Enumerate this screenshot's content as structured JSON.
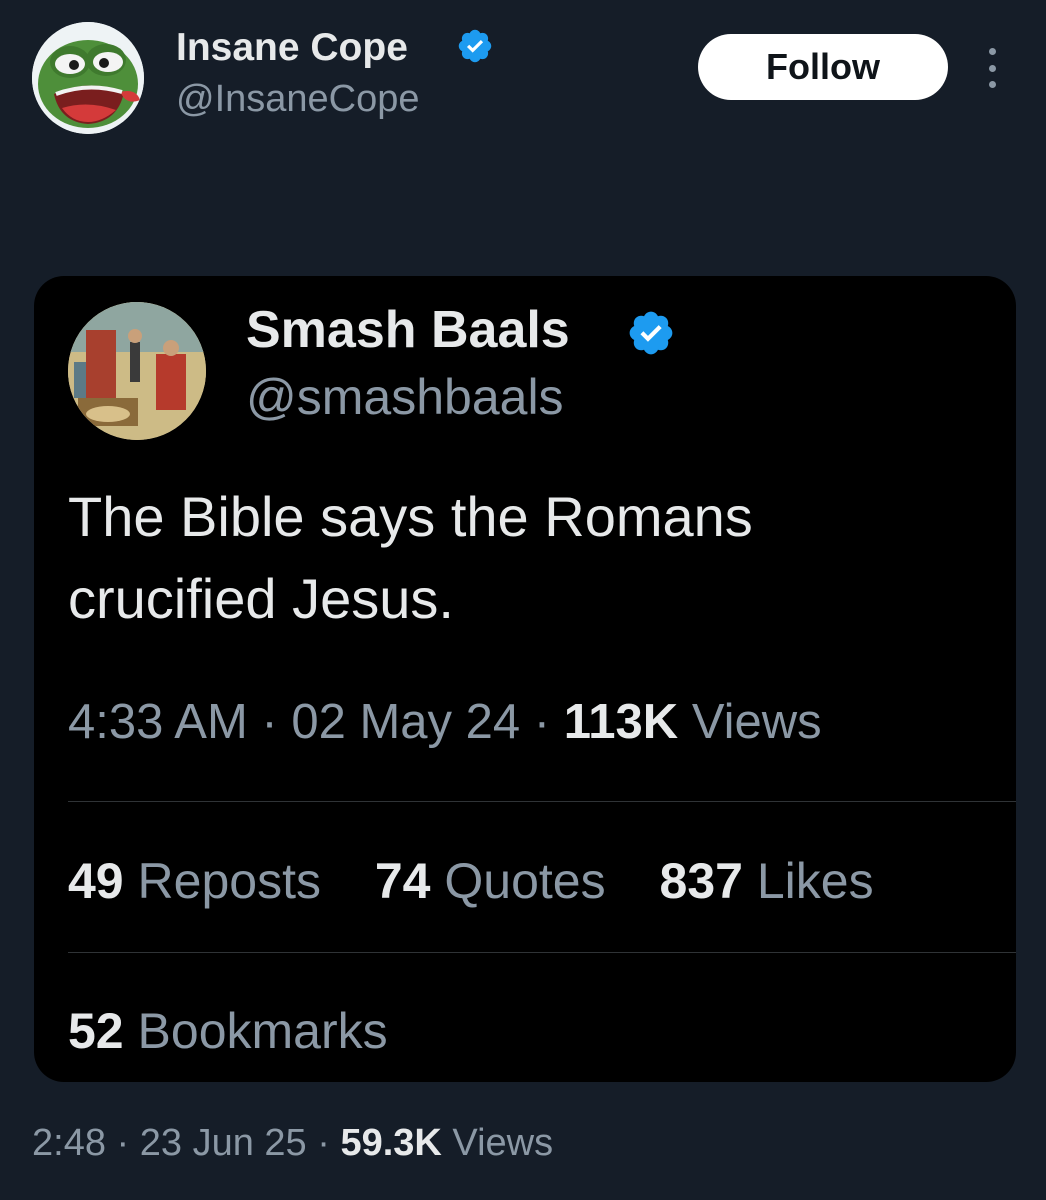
{
  "author": {
    "name": "Insane Cope",
    "handle": "@InsaneCope",
    "verified": true
  },
  "follow_label": "Follow",
  "quoted_tweet": {
    "author_name": "Smash Baals",
    "author_handle": "@smashbaals",
    "verified": true,
    "text": "The Bible says the Romans crucified Jesus.",
    "time": "4:33 AM",
    "date": "02 May 24",
    "views_count": "113K",
    "views_label": "Views",
    "reposts_count": "49",
    "reposts_label": "Reposts",
    "quotes_count": "74",
    "quotes_label": "Quotes",
    "likes_count": "837",
    "likes_label": "Likes",
    "bookmarks_count": "52",
    "bookmarks_label": "Bookmarks"
  },
  "post_meta": {
    "time": "2:48",
    "date": "23 Jun 25",
    "views_count": "59.3K",
    "views_label": "Views"
  },
  "separator": "·",
  "icons": {
    "verified": "verified-badge-icon",
    "more": "more-options-icon"
  },
  "colors": {
    "background": "#151d28",
    "card_background": "#000000",
    "primary_text": "#e7e9ea",
    "secondary_text": "#8b98a5",
    "verified_blue": "#1d9bf0",
    "follow_button": "#ffffff"
  }
}
